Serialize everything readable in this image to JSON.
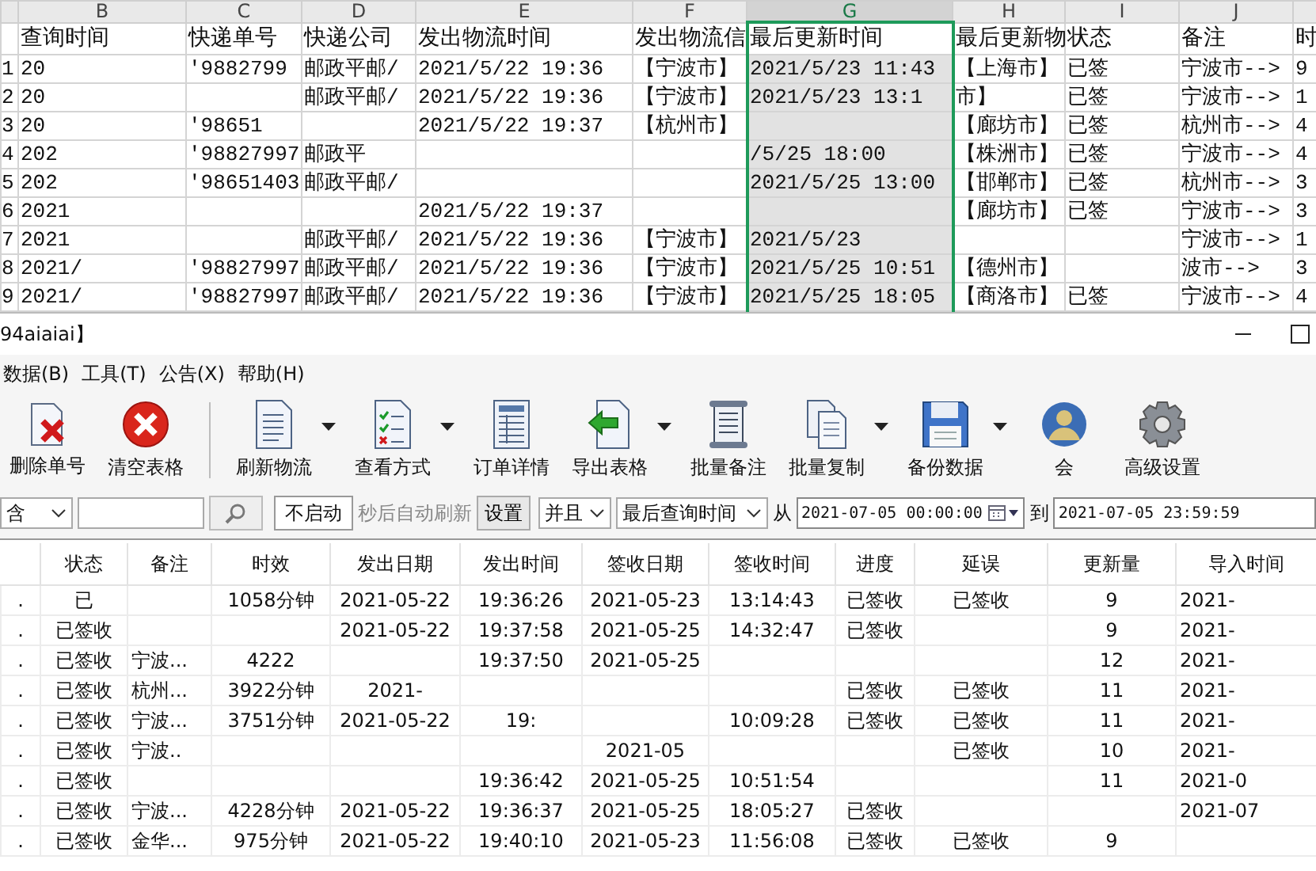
{
  "spreadsheet": {
    "columns": [
      {
        "letter": "B",
        "header": "查询时间",
        "selected": false
      },
      {
        "letter": "C",
        "header": "快递单号",
        "selected": false
      },
      {
        "letter": "D",
        "header": "快递公司",
        "selected": false
      },
      {
        "letter": "E",
        "header": "发出物流时间",
        "selected": false
      },
      {
        "letter": "F",
        "header": "发出物流信",
        "selected": false
      },
      {
        "letter": "G",
        "header": "最后更新时间",
        "selected": true
      },
      {
        "letter": "H",
        "header": "最后更新物",
        "selected": false
      },
      {
        "letter": "I",
        "header": "状态",
        "selected": false
      },
      {
        "letter": "J",
        "header": "备注",
        "selected": false
      },
      {
        "header": "时",
        "selected": false
      }
    ],
    "rows": [
      {
        "number": "1",
        "cells": [
          "20",
          "'9882799",
          "邮政平邮/",
          "2021/5/22 19:36",
          "【宁波市】",
          "2021/5/23 11:43",
          "【上海市】",
          "已签",
          "宁波市-->",
          "9"
        ]
      },
      {
        "number": "2",
        "cells": [
          "20",
          null,
          "邮政平邮/",
          "2021/5/22 19:36",
          "【宁波市】",
          "2021/5/23 13:1",
          "市】",
          "已签",
          "宁波市-->",
          "1"
        ]
      },
      {
        "number": "3",
        "cells": [
          "20",
          "'98651",
          null,
          "2021/5/22 19:37",
          "【杭州市】",
          null,
          "【廊坊市】",
          "已签",
          "杭州市-->",
          "4"
        ]
      },
      {
        "number": "4",
        "cells": [
          "202",
          "'98827997",
          "邮政平",
          null,
          null,
          "/5/25 18:00",
          "【株洲市】",
          "已签",
          "宁波市-->",
          "4"
        ]
      },
      {
        "number": "5",
        "cells": [
          "202",
          "'98651403",
          "邮政平邮/",
          null,
          null,
          "2021/5/25 13:00",
          "【邯郸市】",
          "已签",
          "杭州市-->",
          "3"
        ]
      },
      {
        "number": "6",
        "cells": [
          "2021",
          null,
          null,
          "2021/5/22 19:37",
          null,
          null,
          "【廊坊市】",
          "已签",
          "宁波市-->",
          "3"
        ]
      },
      {
        "number": "7",
        "cells": [
          "2021",
          null,
          "邮政平邮/",
          "2021/5/22 19:36",
          "【宁波市】",
          "2021/5/23",
          null,
          null,
          "宁波市-->",
          "1"
        ]
      },
      {
        "number": "8",
        "cells": [
          "2021/",
          "'98827997",
          "邮政平邮/",
          "2021/5/22 19:36",
          "【宁波市】",
          "2021/5/25 10:51",
          "【德州市】",
          null,
          "波市-->",
          "3"
        ]
      },
      {
        "number": "9",
        "cells": [
          "2021/",
          "'98827997",
          "邮政平邮/",
          "2021/5/22 19:36",
          "【宁波市】",
          "2021/5/25 18:05",
          "【商洛市】",
          "已签",
          "宁波市-->",
          "4"
        ]
      }
    ]
  },
  "window": {
    "title": "94aiaiai】"
  },
  "menu": [
    {
      "label": "数据(B)"
    },
    {
      "label": "工具(T)"
    },
    {
      "label": "公告(X)"
    },
    {
      "label": "帮助(H)"
    }
  ],
  "toolbar": {
    "groups": [
      [
        {
          "label": "删除单号",
          "dropdown": false
        },
        {
          "label": "清空表格",
          "dropdown": false
        }
      ],
      [
        {
          "label": "刷新物流",
          "dropdown": true
        },
        {
          "label": "查看方式",
          "dropdown": true
        },
        {
          "label": "订单详情",
          "dropdown": false
        },
        {
          "label": "导出表格",
          "dropdown": true
        },
        {
          "label": "批量备注",
          "dropdown": false
        },
        {
          "label": "批量复制",
          "dropdown": true
        },
        {
          "label": "备份数据",
          "dropdown": true
        },
        {
          "label": "会",
          "dropdown": false
        },
        {
          "label": "高级设置",
          "dropdown": false
        }
      ]
    ]
  },
  "filter": {
    "match": "含",
    "refresh": "不启动",
    "refresh_label": "秒后自动刷新",
    "settings_button": "设置",
    "logic": "并且",
    "time_field": "最后查询时间",
    "from_label": "从",
    "from": "2021-07-05 00:00:00",
    "to_label": "到",
    "to": "2021-07-05 23:59:59"
  },
  "results": {
    "columns": [
      "",
      "状态",
      "备注",
      "时效",
      "发出日期",
      "发出时间",
      "签收日期",
      "签收时间",
      "进度",
      "延误",
      "更新量",
      "导入时间"
    ],
    "rows": [
      [
        ".",
        "已",
        null,
        "1058分钟",
        "2021-05-22",
        "19:36:26",
        "2021-05-23",
        "13:14:43",
        "已签收",
        "已签收",
        "9",
        "2021-"
      ],
      [
        ".",
        "已签收",
        null,
        null,
        "2021-05-22",
        "19:37:58",
        "2021-05-25",
        "14:32:47",
        "已签收",
        null,
        "9",
        "2021-"
      ],
      [
        ".",
        "已签收",
        "宁波...",
        "4222",
        null,
        "19:37:50",
        "2021-05-25",
        null,
        null,
        null,
        "12",
        "2021-"
      ],
      [
        ".",
        "已签收",
        "杭州...",
        "3922分钟",
        "2021-",
        null,
        null,
        null,
        "已签收",
        "已签收",
        "11",
        "2021-"
      ],
      [
        ".",
        "已签收",
        "宁波...",
        "3751分钟",
        "2021-05-22",
        "19:",
        null,
        "10:09:28",
        "已签收",
        "已签收",
        "11",
        "2021-"
      ],
      [
        ".",
        "已签收",
        "宁波..",
        null,
        null,
        null,
        "2021-05",
        null,
        null,
        "已签收",
        "10",
        "2021-"
      ],
      [
        ".",
        "已签收",
        null,
        null,
        null,
        "19:36:42",
        "2021-05-25",
        "10:51:54",
        null,
        null,
        "11",
        "2021-0"
      ],
      [
        ".",
        "已签收",
        "宁波...",
        "4228分钟",
        "2021-05-22",
        "19:36:37",
        "2021-05-25",
        "18:05:27",
        "已签收",
        null,
        null,
        "2021-07"
      ],
      [
        ".",
        "已签收",
        "金华...",
        "975分钟",
        "2021-05-22",
        "19:40:10",
        "2021-05-23",
        "11:56:08",
        "已签收",
        "已签收",
        "9",
        null
      ]
    ]
  }
}
